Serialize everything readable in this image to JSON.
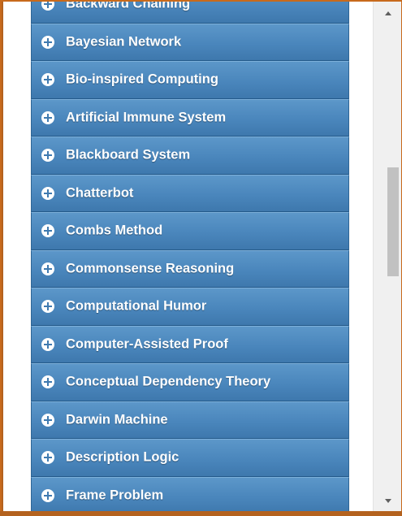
{
  "list": {
    "items": [
      {
        "label": "Backward Chaining"
      },
      {
        "label": "Bayesian Network"
      },
      {
        "label": "Bio-inspired Computing"
      },
      {
        "label": "Artificial Immune System"
      },
      {
        "label": "Blackboard System"
      },
      {
        "label": "Chatterbot"
      },
      {
        "label": "Combs Method"
      },
      {
        "label": "Commonsense Reasoning"
      },
      {
        "label": "Computational Humor"
      },
      {
        "label": "Computer-Assisted Proof"
      },
      {
        "label": "Conceptual Dependency Theory"
      },
      {
        "label": "Darwin Machine"
      },
      {
        "label": "Description Logic"
      },
      {
        "label": "Frame Problem"
      }
    ],
    "expand_icon": "plus-circle-icon"
  },
  "colors": {
    "item_blue": "#4a86bc",
    "frame_orange": "#b4621e",
    "text": "#ffffff"
  }
}
